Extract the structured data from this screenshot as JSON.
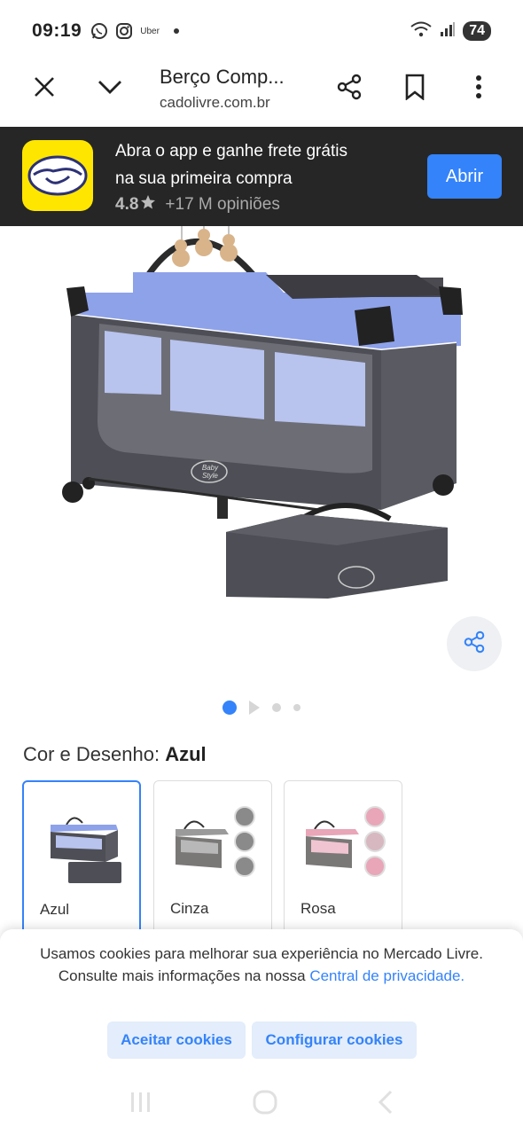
{
  "status_bar": {
    "time": "09:19",
    "uber_label": "Uber",
    "battery": "74"
  },
  "browser": {
    "page_title": "Berço Comp...",
    "url": "cadolivre.com.br"
  },
  "app_banner": {
    "line1": "Abra o app e ganhe frete grátis",
    "line2": "na sua primeira compra",
    "rating": "4.8",
    "opinions": "+17 M opiniões",
    "open_label": "Abrir"
  },
  "product": {
    "image_alt": "Berço portátil azul com bolsa",
    "brand_badge": "Baby Style"
  },
  "gallery": {
    "active_index": 1,
    "count": 4
  },
  "variation": {
    "label": "Cor e Desenho: ",
    "selected": "Azul",
    "options": [
      {
        "name": "Azul",
        "accent": "#7f96e8"
      },
      {
        "name": "Cinza",
        "accent": "#9a9a9a"
      },
      {
        "name": "Rosa",
        "accent": "#e8a6b8"
      }
    ]
  },
  "cookies": {
    "text": "Usamos cookies para melhorar sua experiência no Mercado Livre. Consulte mais informações na nossa ",
    "link": "Central de privacidade.",
    "accept_label": "Aceitar cookies",
    "configure_label": "Configurar cookies"
  },
  "colors": {
    "accent": "#3483fa",
    "banner_bg": "#262626",
    "logo_yellow": "#ffe600"
  }
}
